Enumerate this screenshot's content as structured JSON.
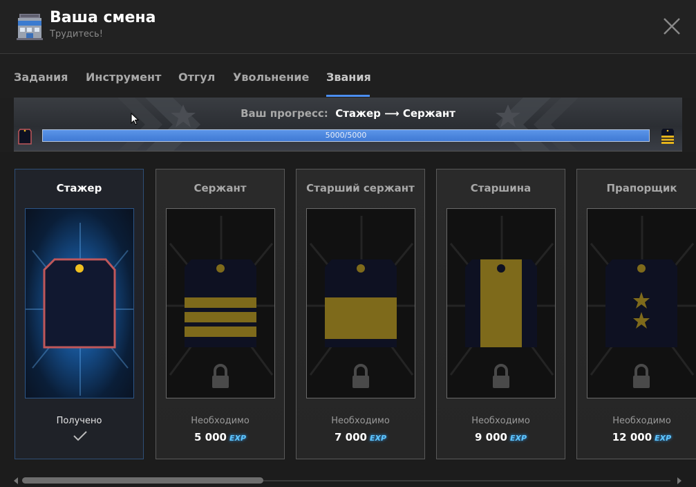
{
  "header": {
    "title": "Ваша смена",
    "subtitle": "Трудитесь!",
    "icon": "building-icon",
    "close_icon": "close-icon"
  },
  "tabs": [
    {
      "label": "Задания",
      "active": false
    },
    {
      "label": "Инструмент",
      "active": false
    },
    {
      "label": "Отгул",
      "active": false
    },
    {
      "label": "Увольнение",
      "active": false
    },
    {
      "label": "Звания",
      "active": true
    }
  ],
  "progress": {
    "label_prefix": "Ваш прогресс:",
    "from_rank": "Стажер",
    "arrow": "⟶",
    "to_rank": "Сержант",
    "current": 5000,
    "total": 5000,
    "text": "5000/5000",
    "fraction": 1.0
  },
  "ranks": [
    {
      "name": "Стажер",
      "status": "Получено",
      "achieved": true,
      "cost": "",
      "insignia": "trainee"
    },
    {
      "name": "Сержант",
      "status": "Необходимо",
      "achieved": false,
      "cost": "5 000",
      "insignia": "sergeant"
    },
    {
      "name": "Старший сержант",
      "status": "Необходимо",
      "achieved": false,
      "cost": "7 000",
      "insignia": "senior-sergeant"
    },
    {
      "name": "Старшина",
      "status": "Необходимо",
      "achieved": false,
      "cost": "9 000",
      "insignia": "sergeant-major"
    },
    {
      "name": "Прапорщик",
      "status": "Необходимо",
      "achieved": false,
      "cost": "12 000",
      "insignia": "warrant-officer"
    }
  ],
  "exp_label": "EXP",
  "colors": {
    "accent": "#4b8ef0",
    "stripe_gold": "#7e6a1b",
    "board_navy": "#0e1122",
    "trainee_border": "#c0575a",
    "button_gold": "#f0c020",
    "exp_cyan": "#5fc6ff"
  }
}
